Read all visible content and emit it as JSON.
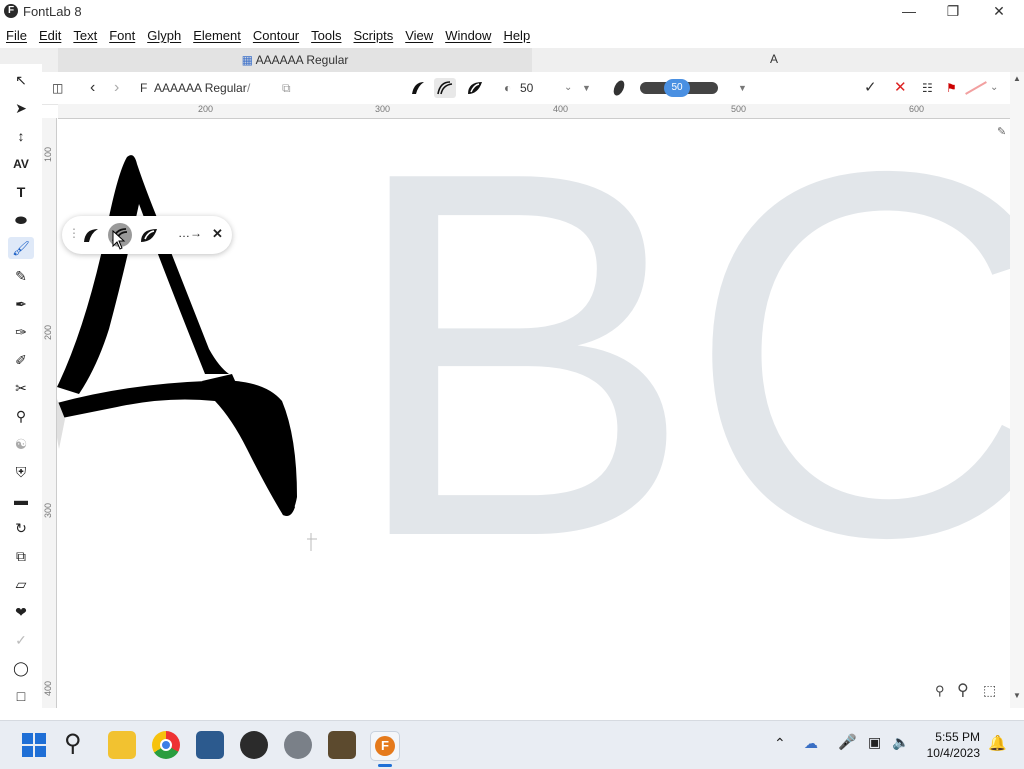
{
  "window": {
    "title": "FontLab 8"
  },
  "menu": [
    "File",
    "Edit",
    "Text",
    "Font",
    "Glyph",
    "Element",
    "Contour",
    "Tools",
    "Scripts",
    "View",
    "Window",
    "Help"
  ],
  "tabs": {
    "active_label": "AAAAAA Regular",
    "glyph_tab": "A"
  },
  "toolbar": {
    "font_name": "AAAAAA Regular",
    "separator": "/",
    "brush_width": "50",
    "brush_slider_value": "50"
  },
  "ruler": {
    "top": [
      "200",
      "300",
      "400",
      "500",
      "600"
    ],
    "left": [
      "100",
      "200",
      "300",
      "400"
    ]
  },
  "canvas": {
    "background_glyphs": "BC"
  },
  "taskbar": {
    "time": "5:55 PM",
    "date": "10/4/2023"
  },
  "colors": {
    "accent": "#1a5fc6",
    "ghost_glyph": "#e2e6ea",
    "stroke": "#000000",
    "taskbar": "#e9edf3"
  }
}
